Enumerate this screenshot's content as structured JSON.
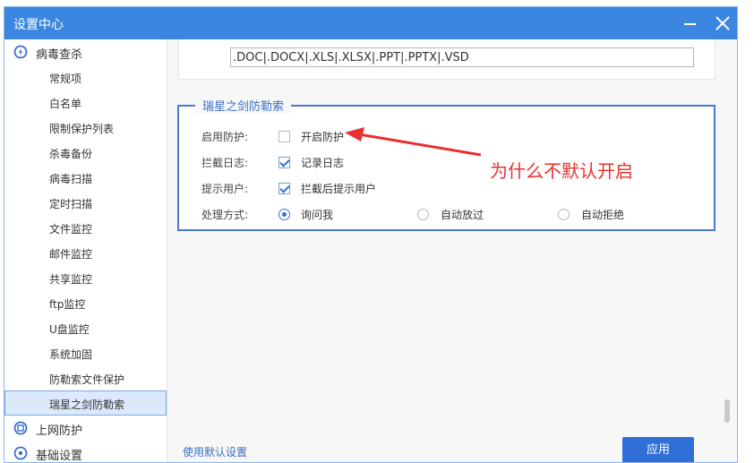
{
  "window": {
    "title": "设置中心"
  },
  "sidebar": {
    "section_virus": "病毒查杀",
    "items": [
      {
        "label": "常规项"
      },
      {
        "label": "白名单"
      },
      {
        "label": "限制保护列表"
      },
      {
        "label": "杀毒备份"
      },
      {
        "label": "病毒扫描"
      },
      {
        "label": "定时扫描"
      },
      {
        "label": "文件监控"
      },
      {
        "label": "邮件监控"
      },
      {
        "label": "共享监控"
      },
      {
        "label": "ftp监控"
      },
      {
        "label": "U盘监控"
      },
      {
        "label": "系统加固"
      },
      {
        "label": "防勒索文件保护"
      },
      {
        "label": "瑞星之剑防勒索",
        "selected": true
      }
    ],
    "section_web": "上网防护",
    "section_basic": "基础设置"
  },
  "extensions": {
    "value": ".DOC|.DOCX|.XLS|.XLSX|.PPT|.PPTX|.VSD"
  },
  "group": {
    "title": "瑞星之剑防勒索",
    "enable_label": "启用防护:",
    "enable_option": "开启防护",
    "enable_checked": false,
    "log_label": "拦截日志:",
    "log_option": "记录日志",
    "log_checked": true,
    "notify_label": "提示用户:",
    "notify_option": "拦截后提示用户",
    "notify_checked": true,
    "action_label": "处理方式:",
    "action_options": [
      "询问我",
      "自动放过",
      "自动拒绝"
    ],
    "action_selected": 0
  },
  "annotation": {
    "text": "为什么不默认开启",
    "color": "#e8302f"
  },
  "footer": {
    "default_link": "使用默认设置",
    "apply_label": "应用"
  },
  "colors": {
    "titlebar": "#3b86e0",
    "accent": "#2f6fd6"
  }
}
